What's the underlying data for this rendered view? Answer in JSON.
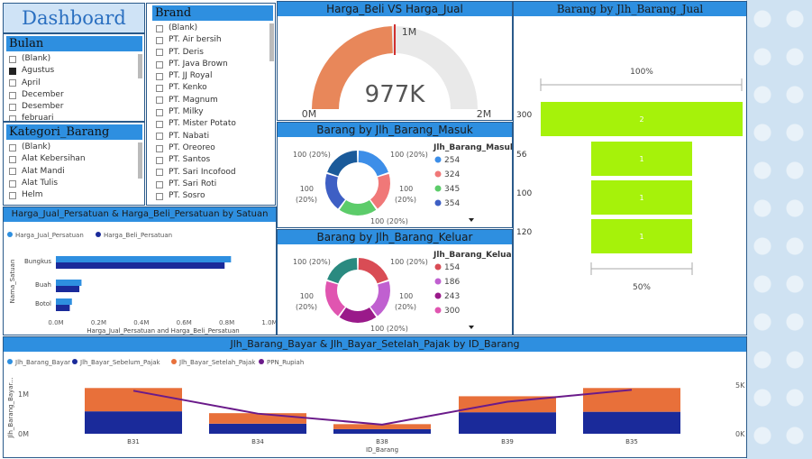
{
  "dashboard": {
    "title": "Dashboard"
  },
  "bulan": {
    "title": "Bulan",
    "items": [
      {
        "label": "(Blank)",
        "checked": false
      },
      {
        "label": "Agustus",
        "checked": true
      },
      {
        "label": "April",
        "checked": false
      },
      {
        "label": "December",
        "checked": false
      },
      {
        "label": "Desember",
        "checked": false
      },
      {
        "label": "februari",
        "checked": false
      }
    ]
  },
  "kategori": {
    "title": "Kategori_Barang",
    "items": [
      "(Blank)",
      "Alat Kebersihan",
      "Alat Mandi",
      "Alat Tulis",
      "Helm"
    ]
  },
  "brand": {
    "title": "Brand",
    "items": [
      "(Blank)",
      "PT. Air bersih",
      "PT. Deris",
      "PT. Java Brown",
      "PT. JJ Royal",
      "PT. Kenko",
      "PT. Magnum",
      "PT. Milky",
      "PT. Mister Potato",
      "PT. Nabati",
      "PT. Oreoreo",
      "PT. Santos",
      "PT. Sari Incofood",
      "PT. Sari Roti",
      "PT. Sosro"
    ]
  },
  "gauge": {
    "title": "Harga_Beli VS Harga_Jual",
    "value_label": "977K",
    "min_label": "0M",
    "max_label": "2M",
    "target_label": "1M",
    "value": 977000,
    "min": 0,
    "max": 2000000,
    "target": 1000000,
    "color": "#e8875a"
  },
  "masuk": {
    "title": "Barang by Jlh_Barang_Masuk",
    "legend_title": "Jlh_Barang_Masuk",
    "legend": [
      {
        "label": "254",
        "color": "#3d8ee8"
      },
      {
        "label": "324",
        "color": "#f07878"
      },
      {
        "label": "345",
        "color": "#5ccc6a"
      },
      {
        "label": "354",
        "color": "#3e5fc4"
      }
    ],
    "slices": [
      {
        "value": 100,
        "color": "#3d8ee8"
      },
      {
        "value": 100,
        "color": "#f07878"
      },
      {
        "value": 100,
        "color": "#5ccc6a"
      },
      {
        "value": 100,
        "color": "#3e5fc4"
      },
      {
        "value": 100,
        "color": "#1a5a9a"
      }
    ],
    "labels": {
      "tl": "100 (20%)",
      "tr": "100 (20%)",
      "ml1": "100",
      "ml2": "(20%)",
      "mr1": "100",
      "mr2": "(20%)",
      "bot": "100 (20%)"
    }
  },
  "keluar": {
    "title": "Barang by Jlh_Barang_Keluar",
    "legend_title": "Jlh_Barang_Keluar",
    "legend": [
      {
        "label": "154",
        "color": "#d94c55"
      },
      {
        "label": "186",
        "color": "#c060d0"
      },
      {
        "label": "243",
        "color": "#9a1a8a"
      },
      {
        "label": "300",
        "color": "#e055b0"
      }
    ],
    "slices": [
      {
        "value": 100,
        "color": "#d94c55"
      },
      {
        "value": 100,
        "color": "#c060d0"
      },
      {
        "value": 100,
        "color": "#9a1a8a"
      },
      {
        "value": 100,
        "color": "#e055b0"
      },
      {
        "value": 100,
        "color": "#2a8a80"
      }
    ],
    "labels": {
      "tl": "100 (20%)",
      "tr": "100 (20%)",
      "ml1": "100",
      "ml2": "(20%)",
      "mr1": "100",
      "mr2": "(20%)",
      "bot": "100 (20%)"
    }
  },
  "funnel": {
    "title": "Barang by Jlh_Barang_Jual",
    "top_label": "100%",
    "bottom_label": "50%",
    "color": "#a6f20a",
    "rows": [
      {
        "category": "300",
        "value": 2
      },
      {
        "category": "56",
        "value": 1
      },
      {
        "category": "100",
        "value": 1
      },
      {
        "category": "120",
        "value": 1
      }
    ]
  },
  "bar_satuan": {
    "title": "Harga_Jual_Persatuan & Harga_Beli_Persatuan by Satuan"
  },
  "combo": {
    "title": "Jlh_Barang_Bayar & Jlh_Bayar_Setelah_Pajak by ID_Barang"
  },
  "chart_data": [
    {
      "type": "bar",
      "orientation": "horizontal",
      "title": "Harga_Jual_Persatuan & Harga_Beli_Persatuan by Satuan",
      "categories": [
        "Bungkus",
        "Buah",
        "Botol"
      ],
      "series": [
        {
          "name": "Harga_Jual_Persatuan",
          "color": "#2e8fe0",
          "values": [
            820000,
            120000,
            75000
          ]
        },
        {
          "name": "Harga_Beli_Persatuan",
          "color": "#1a2a9a",
          "values": [
            790000,
            110000,
            65000
          ]
        }
      ],
      "xlabel": "Harga_Jual_Persatuan and Harga_Beli_Persatuan",
      "ylabel": "Nama_Satuan",
      "xticks": [
        "0.0M",
        "0.2M",
        "0.4M",
        "0.6M",
        "0.8M",
        "1.0M"
      ],
      "xlim": [
        0,
        1000000
      ]
    },
    {
      "type": "bar",
      "stacked": true,
      "title": "Jlh_Barang_Bayar & Jlh_Bayar_Setelah_Pajak by ID_Barang",
      "categories": [
        "B31",
        "B34",
        "B38",
        "B39",
        "B35"
      ],
      "series": [
        {
          "name": "Jlh_Barang_Bayar",
          "color": "#2e8fe0",
          "values": [
            0,
            0,
            0,
            0,
            0
          ]
        },
        {
          "name": "Jlh_Bayar_Sebelum_Pajak",
          "color": "#1a2a9a",
          "values": [
            490000,
            220000,
            100000,
            470000,
            480000
          ]
        },
        {
          "name": "Jlh_Bayar_Setelah_Pajak",
          "color": "#e8703a",
          "values": [
            510000,
            230000,
            110000,
            350000,
            520000
          ]
        },
        {
          "name": "PPN_Rupiah",
          "color": "#6a1a8a",
          "type": "line",
          "axis": "right",
          "values": [
            4700,
            2200,
            1000,
            3500,
            4800
          ]
        }
      ],
      "xlabel": "ID_Barang",
      "ylabel": "Jlh_Barang_Bayar...",
      "yticks": [
        "0M",
        "1M"
      ],
      "y2ticks": [
        "0K",
        "5K"
      ],
      "ylim": [
        0,
        1400000
      ],
      "y2lim": [
        0,
        7000
      ]
    }
  ]
}
